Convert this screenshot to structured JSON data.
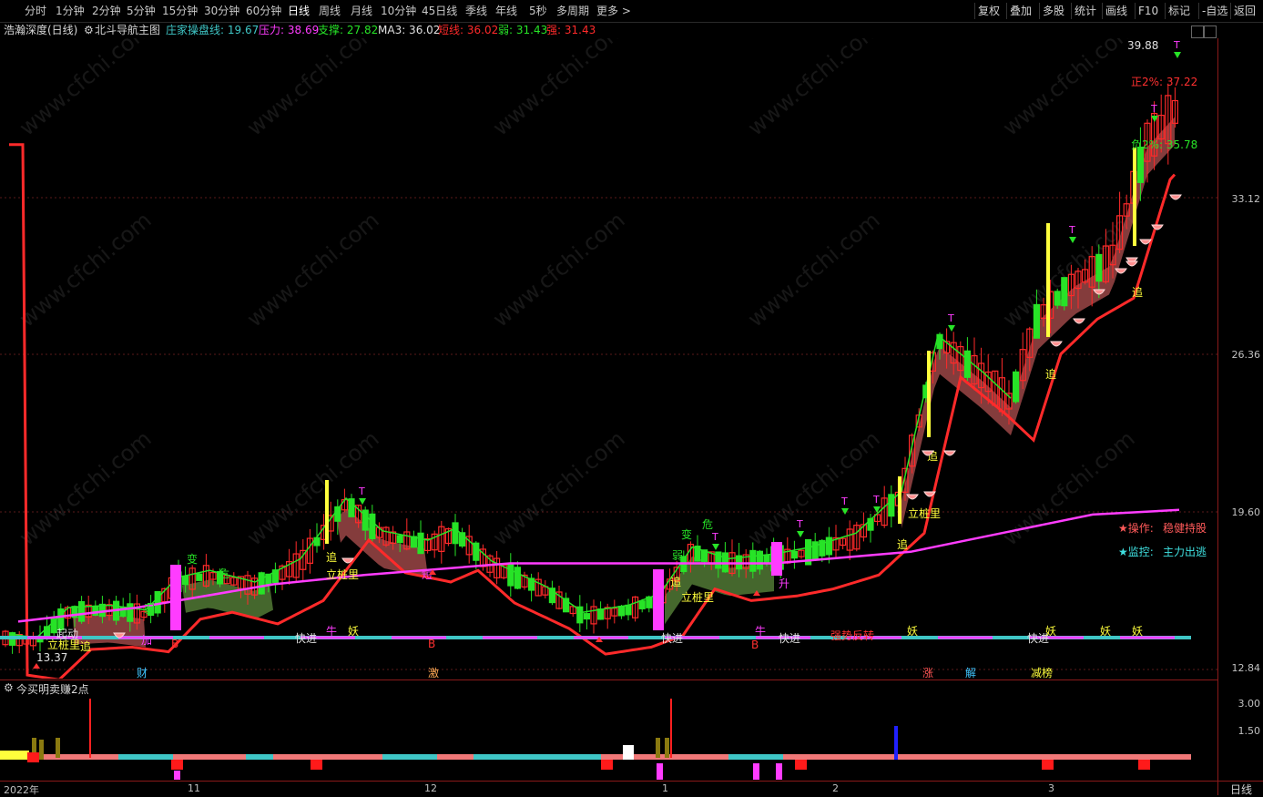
{
  "toolbar": {
    "periods": [
      "分时",
      "1分钟",
      "2分钟",
      "5分钟",
      "15分钟",
      "30分钟",
      "60分钟",
      "日线",
      "周线",
      "月线",
      "10分钟",
      "45日线",
      "季线",
      "年线",
      "5秒",
      "多周期",
      "更多 >"
    ],
    "active_period": "日线",
    "right_buttons": [
      "复权",
      "叠加",
      "多股",
      "统计",
      "画线",
      "F10",
      "标记",
      "-自选",
      "返回"
    ]
  },
  "legend": {
    "stock": "浩瀚深度(日线)",
    "indicator": "北斗导航主图",
    "items": [
      {
        "label": "庄家操盘线:",
        "value": "19.67",
        "color": "#3fc6c6"
      },
      {
        "label": "压力:",
        "value": "38.69",
        "color": "#ff3cff"
      },
      {
        "label": "支撑:",
        "value": "27.82",
        "color": "#27e327"
      },
      {
        "label": "MA3:",
        "value": "36.02",
        "color": "#e0e0e0"
      },
      {
        "label": "短线:",
        "value": "36.02",
        "color": "#ff2a2a"
      },
      {
        "label": "弱:",
        "value": "31.43",
        "color": "#27e327"
      },
      {
        "label": "强:",
        "value": "31.43",
        "color": "#ff2a2a"
      }
    ]
  },
  "price_axis": [
    "33.12",
    "26.36",
    "19.60",
    "12.84"
  ],
  "sub_axis": [
    "3.00",
    "1.50"
  ],
  "sub_title": "今买明卖赚2点",
  "time_axis": [
    "2022年",
    "11",
    "12",
    "1",
    "2",
    "3"
  ],
  "corner_label": "日线",
  "watermark": "www.cfchi.com",
  "info_box": {
    "operation_label": "★操作:",
    "operation_value": "稳健持股",
    "monitor_label": "★监控:",
    "monitor_value": "主力出逃"
  },
  "price_notes": {
    "high": "39.88",
    "low": "13.37",
    "pos": "正2%: 37.22",
    "neg": "负2%: 35.78"
  },
  "signals": {
    "add": "加",
    "buy": "B",
    "quick_in": "快进",
    "niu": "牛",
    "yao": "妖",
    "cai": "财",
    "ji": "激",
    "zhang": "涨",
    "jie": "解",
    "jianbang": "减榜",
    "zhui": "追",
    "lizhuangli": "立桩里",
    "ruo": "弱",
    "bian": "变",
    "wei": "危",
    "t": "T",
    "duan": "短",
    "sheng": "升",
    "qiangshi": "强势反转",
    "qidong": "起动"
  },
  "colors": {
    "up": "#ff2a2a",
    "down": "#27e327",
    "magenta": "#ff3cff",
    "cyan": "#3fc6c6",
    "yellow": "#ffff3c",
    "band_red": "#b05050",
    "band_green": "#5c8a3c"
  }
}
